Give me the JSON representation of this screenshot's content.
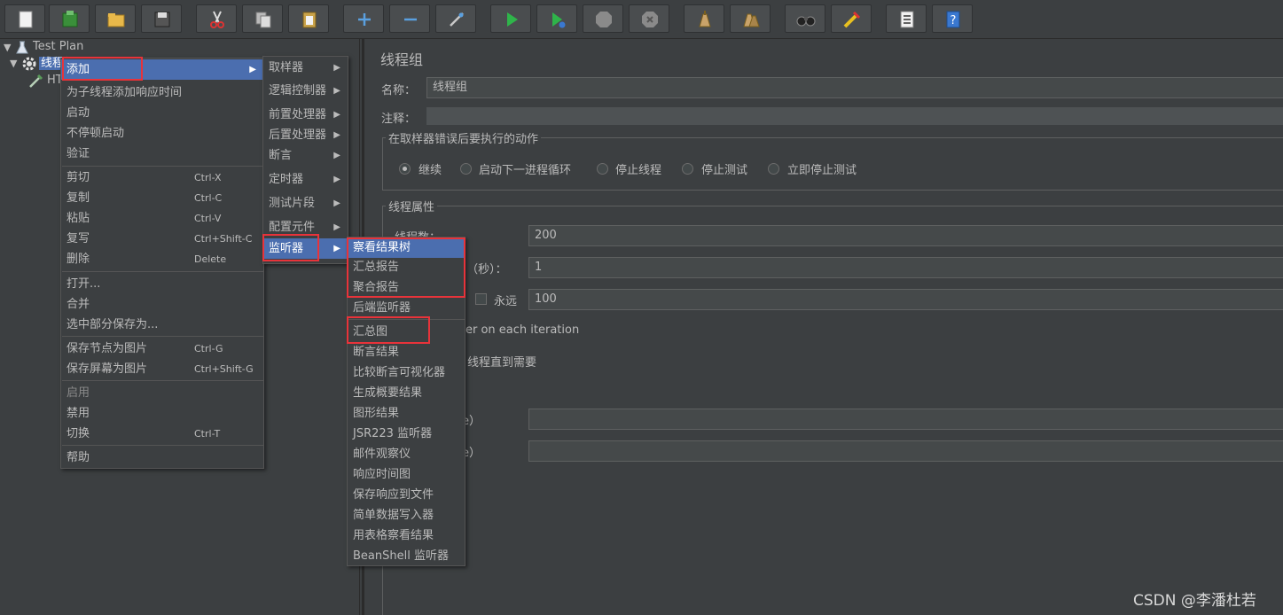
{
  "tree": {
    "root_label": "Test Plan",
    "thread_group_label": "线程组",
    "http_label": "HT"
  },
  "panel": {
    "title": "线程组",
    "name_label": "名称：",
    "name_value": "线程组",
    "comment_label": "注释：",
    "error_group_title": "在取样器错误后要执行的动作",
    "error_options": [
      "继续",
      "启动下一进程循环",
      "停止线程",
      "停止测试",
      "立即停止测试"
    ],
    "thread_props_title": "线程属性",
    "threads_label": "线程数：",
    "threads_value": "200",
    "rampup_label": "]（秒）：",
    "rampup_value": "1",
    "forever_label": "永远",
    "loop_value": "100",
    "same_user_label": "er on each iteration",
    "delay_label": "线程直到需要",
    "duration_label": "e）",
    "startup_label": "e）"
  },
  "context_menu": {
    "items": [
      {
        "label": "添加",
        "shortcut": "",
        "submenu": true,
        "highlight": true
      },
      {
        "label": "为子线程添加响应时间",
        "shortcut": ""
      },
      {
        "label": "启动",
        "shortcut": ""
      },
      {
        "label": "不停顿启动",
        "shortcut": ""
      },
      {
        "label": "验证",
        "shortcut": ""
      },
      {
        "label": "剪切",
        "shortcut": "Ctrl-X"
      },
      {
        "label": "复制",
        "shortcut": "Ctrl-C"
      },
      {
        "label": "粘贴",
        "shortcut": "Ctrl-V"
      },
      {
        "label": "复写",
        "shortcut": "Ctrl+Shift-C"
      },
      {
        "label": "删除",
        "shortcut": "Delete"
      },
      {
        "label": "打开...",
        "shortcut": ""
      },
      {
        "label": "合并",
        "shortcut": ""
      },
      {
        "label": "选中部分保存为...",
        "shortcut": ""
      },
      {
        "label": "保存节点为图片",
        "shortcut": "Ctrl-G"
      },
      {
        "label": "保存屏幕为图片",
        "shortcut": "Ctrl+Shift-G"
      },
      {
        "label": "启用",
        "shortcut": "",
        "disabled": true
      },
      {
        "label": "禁用",
        "shortcut": ""
      },
      {
        "label": "切换",
        "shortcut": "Ctrl-T"
      },
      {
        "label": "帮助",
        "shortcut": ""
      }
    ]
  },
  "add_submenu": {
    "items": [
      {
        "label": "取样器"
      },
      {
        "label": "逻辑控制器"
      },
      {
        "label": "前置处理器"
      },
      {
        "label": "后置处理器"
      },
      {
        "label": "断言"
      },
      {
        "label": "定时器"
      },
      {
        "label": "测试片段"
      },
      {
        "label": "配置元件"
      },
      {
        "label": "监听器",
        "highlight": true
      }
    ]
  },
  "listener_submenu": {
    "items": [
      {
        "label": "察看结果树",
        "highlight": true
      },
      {
        "label": "汇总报告"
      },
      {
        "label": "聚合报告"
      },
      {
        "label": "后端监听器"
      },
      {
        "label": "汇总图"
      },
      {
        "label": "断言结果"
      },
      {
        "label": "比较断言可视化器"
      },
      {
        "label": "生成概要结果"
      },
      {
        "label": "图形结果"
      },
      {
        "label": "JSR223 监听器"
      },
      {
        "label": "邮件观察仪"
      },
      {
        "label": "响应时间图"
      },
      {
        "label": "保存响应到文件"
      },
      {
        "label": "简单数据写入器"
      },
      {
        "label": "用表格察看结果"
      },
      {
        "label": "BeanShell 监听器"
      }
    ]
  },
  "toolbar": {
    "icons": [
      "new-icon",
      "templates-icon",
      "open-icon",
      "save-icon",
      "cut-icon",
      "copy-icon",
      "paste-icon",
      "expand-icon",
      "collapse-icon",
      "toggle-icon",
      "start-icon",
      "start-no-pause-icon",
      "stop-icon",
      "shutdown-icon",
      "clear-icon",
      "clear-all-icon",
      "search-icon",
      "reset-search-icon",
      "function-helper-icon",
      "help-icon"
    ]
  },
  "colors": {
    "background": "#3c3f41",
    "highlight": "#4b6eaf",
    "annotation_red": "#e8333a"
  },
  "watermark": "CSDN @李潘杜若"
}
